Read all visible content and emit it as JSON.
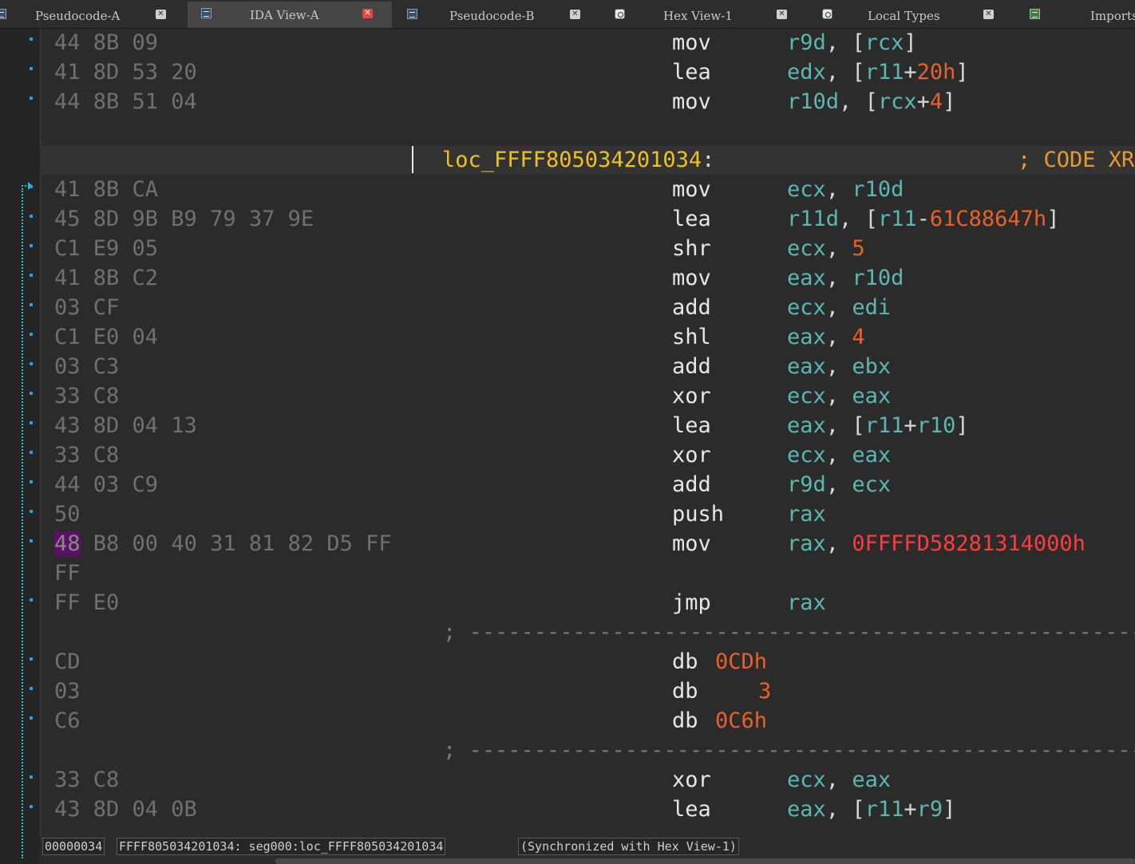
{
  "tabs": [
    {
      "label": "Pseudocode-A",
      "active": false,
      "icon": "pseudocode-icon"
    },
    {
      "label": "IDA View-A",
      "active": true,
      "icon": "ida-view-icon"
    },
    {
      "label": "Pseudocode-B",
      "active": false,
      "icon": "pseudocode-icon"
    },
    {
      "label": "Hex View-1",
      "active": false,
      "icon": "hex-view-icon"
    },
    {
      "label": "Local Types",
      "active": false,
      "icon": "local-types-icon"
    },
    {
      "label": "Imports",
      "active": false,
      "icon": "imports-icon"
    }
  ],
  "listing": {
    "row1": {
      "hex": "44 8B 09",
      "mnemonic": "mov",
      "op1": "r9d",
      "comma": ",",
      "lb": "[",
      "op2": "rcx",
      "rb": "]"
    },
    "row2": {
      "hex": "41 8D 53 20",
      "mnemonic": "lea",
      "op1": "edx",
      "comma": ",",
      "lb": "[",
      "op2a": "r11",
      "plus": "+",
      "op2b": "20h",
      "rb": "]"
    },
    "row3": {
      "hex": "44 8B 51 04",
      "mnemonic": "mov",
      "op1": "r10d",
      "comma": ",",
      "lb": "[",
      "op2a": "rcx",
      "plus": "+",
      "op2b": "4",
      "rb": "]"
    },
    "label": {
      "name": "loc_FFFF805034201034",
      "colon": ":",
      "comment": "; CODE XREF"
    },
    "row4": {
      "hex": "41 8B CA",
      "mnemonic": "mov",
      "op1": "ecx",
      "comma": ",",
      "op2": "r10d"
    },
    "row5": {
      "hex": "45 8D 9B B9 79 37 9E",
      "mnemonic": "lea",
      "op1": "r11d",
      "comma": ",",
      "lb": "[",
      "op2a": "r11",
      "minus": "-",
      "op2b": "61C88647h",
      "rb": "]"
    },
    "row6": {
      "hex": "C1 E9 05",
      "mnemonic": "shr",
      "op1": "ecx",
      "comma": ",",
      "op2": "5"
    },
    "row7": {
      "hex": "41 8B C2",
      "mnemonic": "mov",
      "op1": "eax",
      "comma": ",",
      "op2": "r10d"
    },
    "row8": {
      "hex": "03 CF",
      "mnemonic": "add",
      "op1": "ecx",
      "comma": ",",
      "op2": "edi"
    },
    "row9": {
      "hex": "C1 E0 04",
      "mnemonic": "shl",
      "op1": "eax",
      "comma": ",",
      "op2": "4"
    },
    "row10": {
      "hex": "03 C3",
      "mnemonic": "add",
      "op1": "eax",
      "comma": ",",
      "op2": "ebx"
    },
    "row11": {
      "hex": "33 C8",
      "mnemonic": "xor",
      "op1": "ecx",
      "comma": ",",
      "op2": "eax"
    },
    "row12": {
      "hex": "43 8D 04 13",
      "mnemonic": "lea",
      "op1": "eax",
      "comma": ",",
      "lb": "[",
      "op2a": "r11",
      "plus": "+",
      "op2b": "r10",
      "rb": "]"
    },
    "row13": {
      "hex": "33 C8",
      "mnemonic": "xor",
      "op1": "ecx",
      "comma": ",",
      "op2": "eax"
    },
    "row14": {
      "hex": "44 03 C9",
      "mnemonic": "add",
      "op1": "r9d",
      "comma": ",",
      "op2": "ecx"
    },
    "row15": {
      "hex": "50",
      "mnemonic": "push",
      "op1": "rax"
    },
    "row16": {
      "hex_selected": "48",
      "hex_rest": "B8 00 40 31 81 82 D5 FF",
      "mnemonic": "mov",
      "op1": "rax",
      "comma": ",",
      "op2": "0FFFFD58281314000h"
    },
    "row16b": {
      "hex": "FF"
    },
    "row17": {
      "hex": "FF E0",
      "mnemonic": "jmp",
      "op1": "rax"
    },
    "separator": "; -----------------------------------------------------------",
    "row18": {
      "hex": "CD",
      "mnemonic": "db",
      "op1": "0CDh"
    },
    "row19": {
      "hex": "03",
      "mnemonic": "db",
      "op1": "3"
    },
    "row20": {
      "hex": "C6",
      "mnemonic": "db",
      "op1": "0C6h"
    },
    "row21": {
      "hex": "33 C8",
      "mnemonic": "xor",
      "op1": "ecx",
      "comma": ",",
      "op2": "eax"
    },
    "row22": {
      "hex": "43 8D 04 0B",
      "mnemonic": "lea",
      "op1": "eax",
      "comma": ",",
      "lb": "[",
      "op2a": "r11",
      "plus": "+",
      "op2b": "r9",
      "rb": "]"
    }
  },
  "status": {
    "offset": "00000034",
    "location": "FFFF805034201034: seg000:loc_FFFF805034201034",
    "sync": "(Synchronized with Hex View-1)"
  },
  "colors": {
    "register": "#5ab8b0",
    "number": "#e8602c",
    "address_constant": "#ff3c3c",
    "label": "#f0c020",
    "comment": "#e89a30",
    "flow_arrow": "#19c8c8",
    "breakpoint_dot": "#1ea6ff",
    "selection": "#5b1066"
  }
}
